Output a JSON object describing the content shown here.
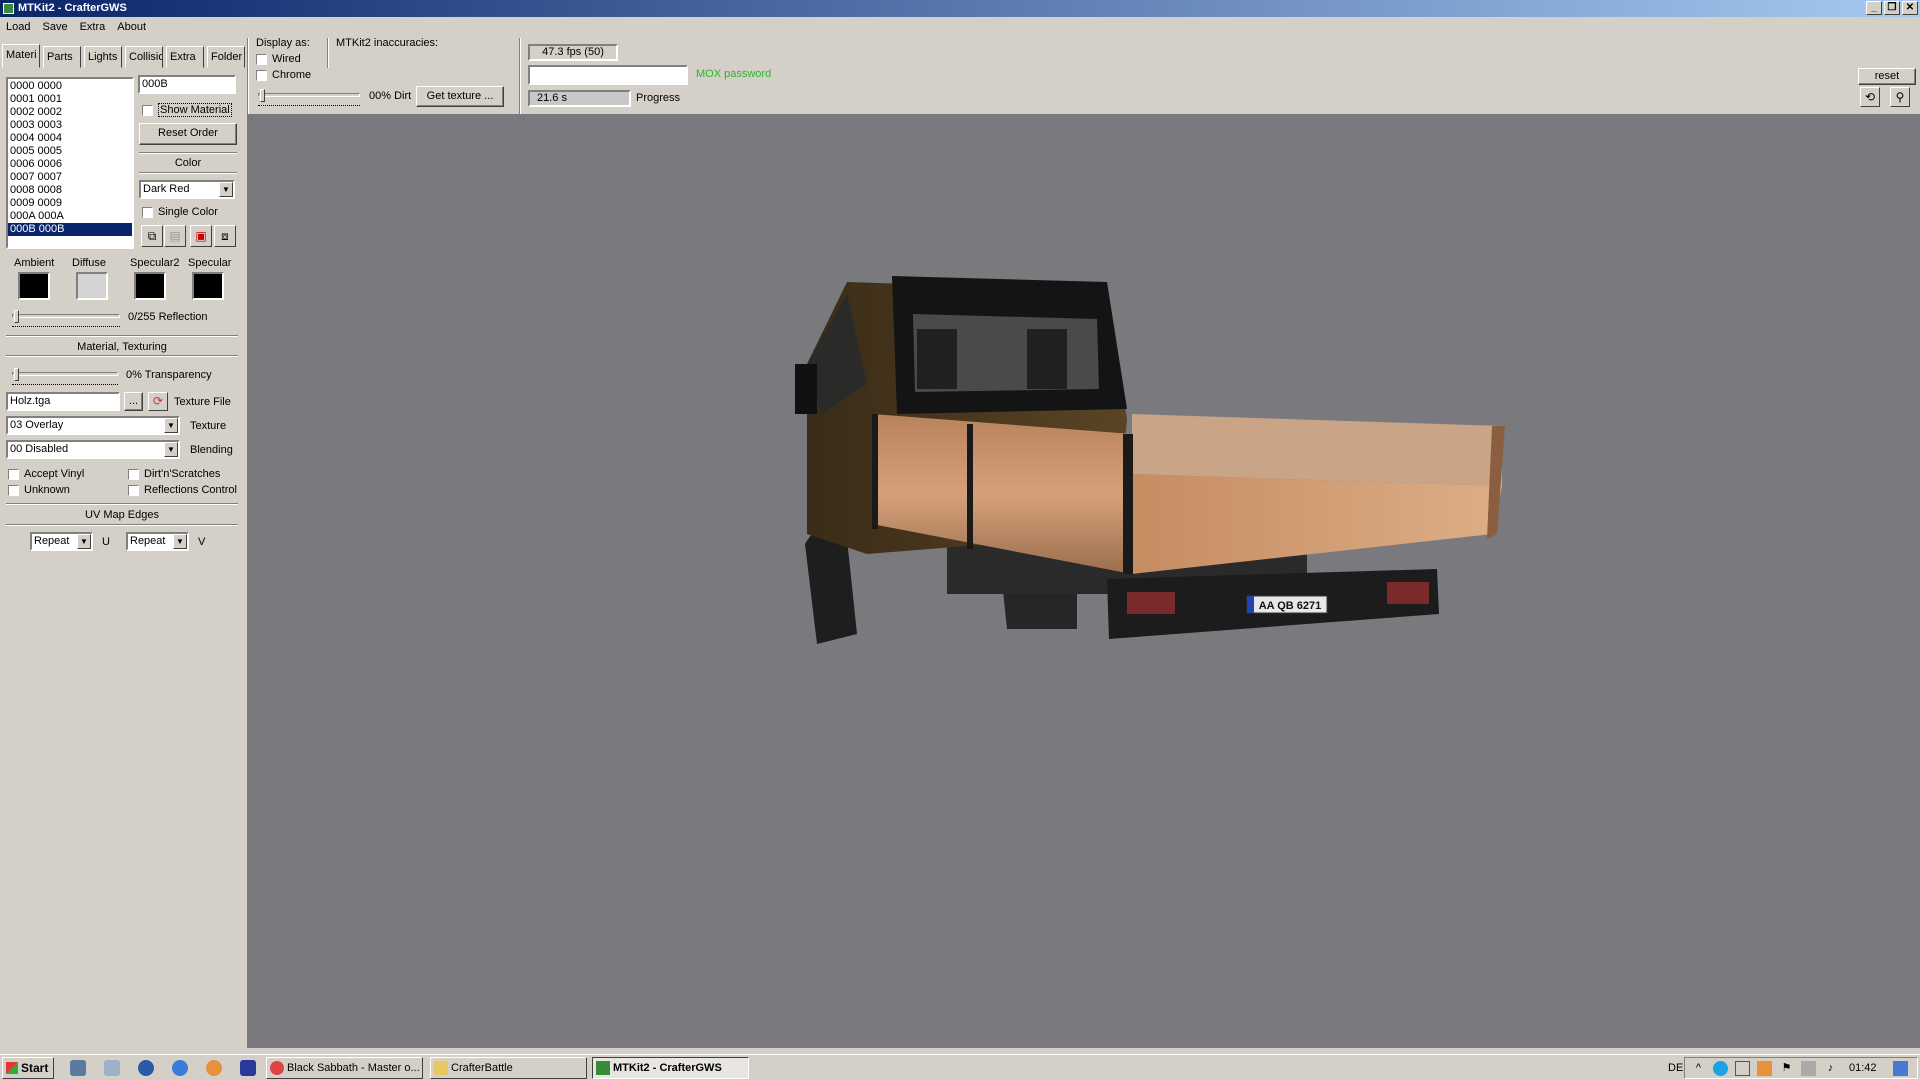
{
  "window": {
    "title": "MTKit2 - CrafterGWS",
    "controls": [
      "_",
      "❐",
      "✕"
    ]
  },
  "menu": [
    "Load",
    "Save",
    "Extra",
    "About"
  ],
  "tabs": [
    "Materi",
    "Parts",
    "Lights",
    "Collisio",
    "Extra",
    "Folder"
  ],
  "display": {
    "label": "Display as:",
    "wired": "Wired",
    "chrome": "Chrome",
    "dirt_label": "00% Dirt",
    "get_texture": "Get texture ...",
    "inaccuracies": "MTKit2 inaccuracies:"
  },
  "stats": {
    "fps": "47.3 fps (50)",
    "password_label": "MOX password",
    "password_value": "",
    "time": "21.6 s",
    "progress_label": "Progress",
    "progress_fraction": 1.0
  },
  "view_controls": {
    "reset": "reset",
    "rotate_icon": "rotate-icon",
    "zoom_icon": "magnifier-icon"
  },
  "materials": {
    "items": [
      "0000 0000",
      "0001 0001",
      "0002 0002",
      "0003 0003",
      "0004 0004",
      "0005 0005",
      "0006 0006",
      "0007 0007",
      "0008 0008",
      "0009 0009",
      "000A 000A",
      "000B 000B"
    ],
    "selected_index": 11,
    "name_value": "000B",
    "show_material": "Show Material",
    "reset_order": "Reset Order",
    "color_heading": "Color",
    "color_value": "Dark Red",
    "single_color": "Single Color"
  },
  "swatches": {
    "ambient": {
      "label": "Ambient",
      "color": "#000000"
    },
    "diffuse": {
      "label": "Diffuse",
      "color": "#d4d4d4"
    },
    "specular2": {
      "label": "Specular2",
      "color": "#000000"
    },
    "specular": {
      "label": "Specular",
      "color": "#000000"
    }
  },
  "reflection_label": "0/255 Reflection",
  "texturing": {
    "heading": "Material, Texturing",
    "transparency_label": "0% Transparency",
    "texture_file_value": "Holz.tga",
    "browse": "...",
    "texture_file_label": "Texture File",
    "texture_value": "03 Overlay",
    "texture_label": "Texture",
    "blending_value": "00 Disabled",
    "blending_label": "Blending",
    "accept_vinyl": "Accept Vinyl",
    "dirt_scratches": "Dirt'n'Scratches",
    "unknown": "Unknown",
    "reflections_control": "Reflections Control"
  },
  "uv": {
    "heading": "UV Map Edges",
    "u_value": "Repeat",
    "u_label": "U",
    "v_value": "Repeat",
    "v_label": "V"
  },
  "viewport": {
    "plate": "AA QB 6271",
    "background": "#7a7a7e"
  },
  "taskbar": {
    "start": "Start",
    "tasks": [
      "Black Sabbath - Master o...",
      "CrafterBattle",
      "MTKit2 - CrafterGWS"
    ],
    "language": "DE",
    "clock": "01:42"
  }
}
